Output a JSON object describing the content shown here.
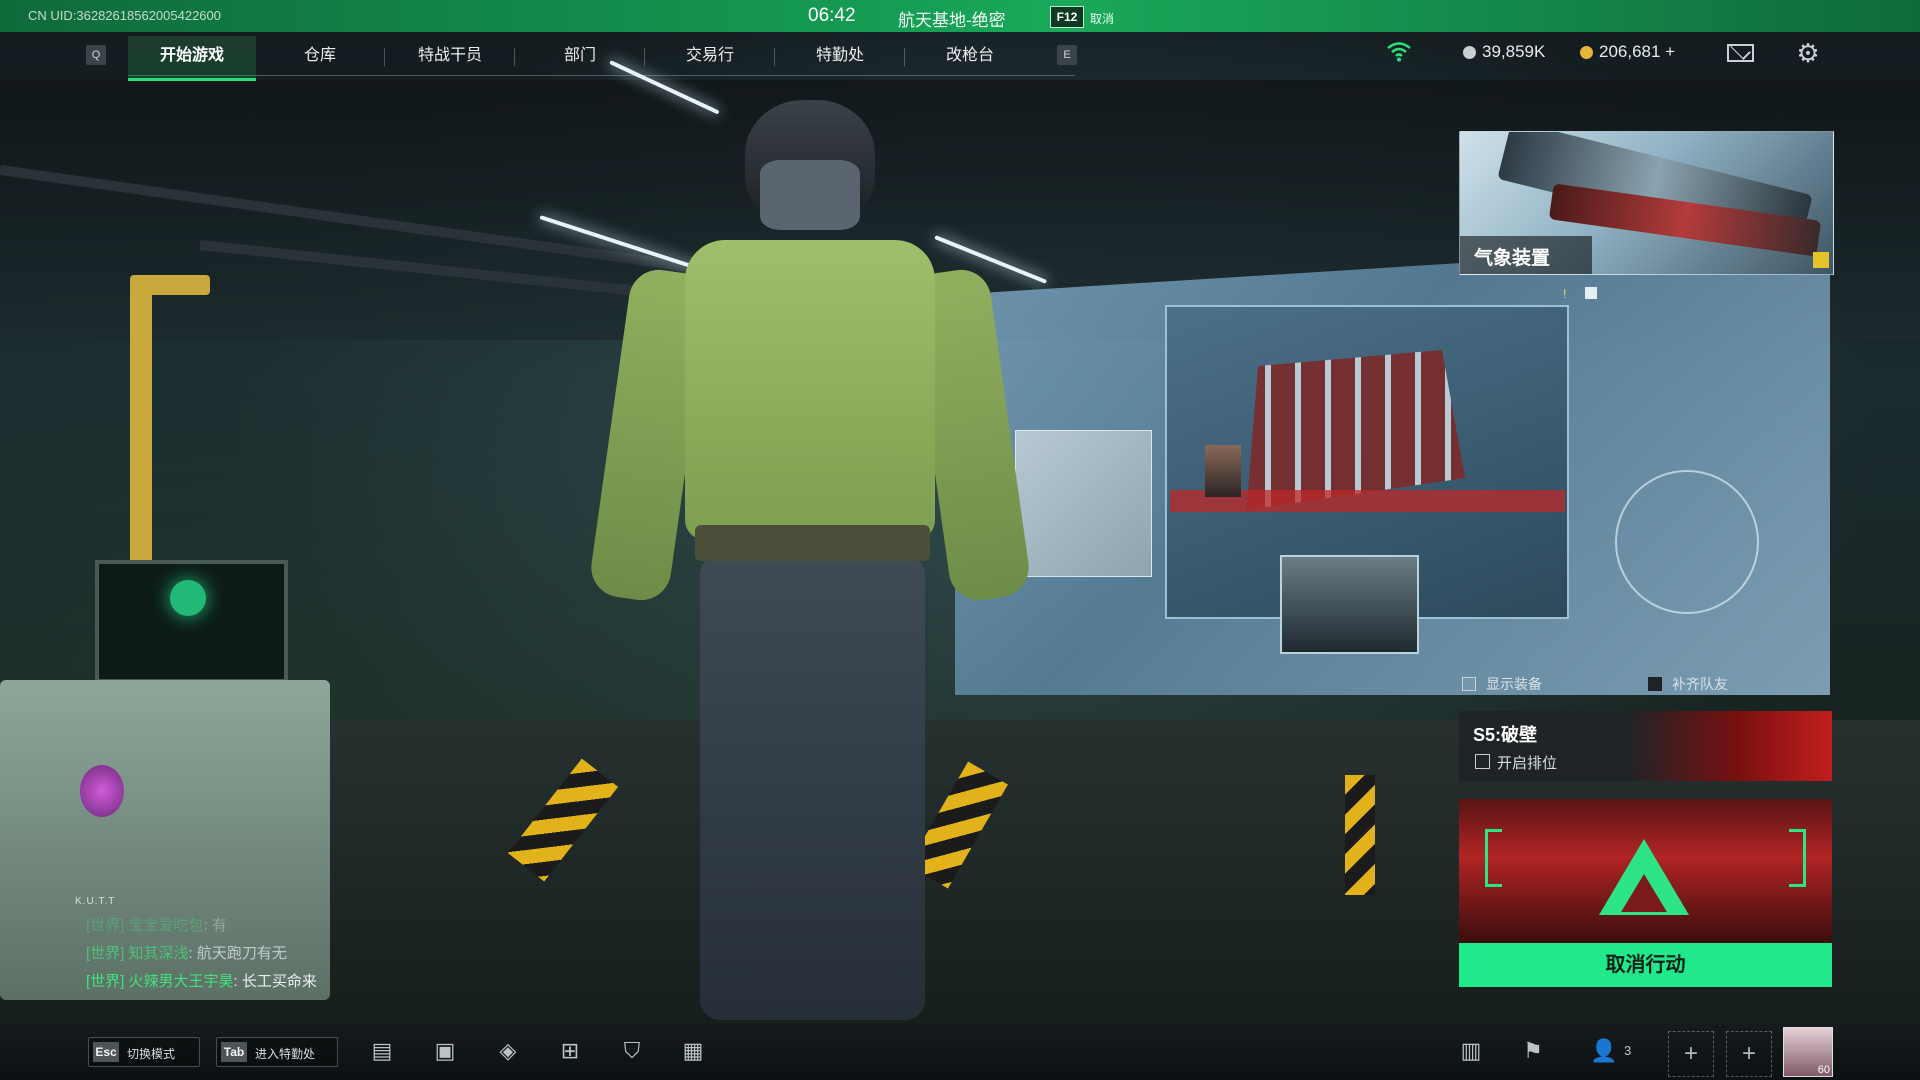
{
  "statusbar": {
    "uid": "CN UID:3628261856200542260​0",
    "clock": "06:42",
    "map_name": "航天基地-绝密",
    "f12_key": "F12",
    "f12_label": "取消"
  },
  "nav": {
    "left_key": "Q",
    "right_key": "E",
    "tabs": [
      {
        "label": "开始游戏",
        "active": true
      },
      {
        "label": "仓库",
        "active": false
      },
      {
        "label": "特战干员",
        "active": false
      },
      {
        "label": "部门",
        "active": false
      },
      {
        "label": "交易行",
        "active": false
      },
      {
        "label": "特勤处",
        "active": false
      },
      {
        "label": "改枪台",
        "active": false
      }
    ]
  },
  "hud": {
    "currency_silver": "39,859K",
    "currency_gold": "206,681 +",
    "icons": [
      "wifi-icon",
      "mail-icon",
      "gear-icon"
    ],
    "colors": {
      "accent": "#21e88a",
      "statusbar": "#159b52",
      "gold": "#e6b43a",
      "silver": "#c9d0d4"
    }
  },
  "promo": {
    "title": "气象装置"
  },
  "options": {
    "show_gear": "显示装备",
    "fill_team": "补齐队友"
  },
  "season": {
    "title": "S5:破壁",
    "ranked_label": "开启排位"
  },
  "action": {
    "cancel_label": "取消行动"
  },
  "chat": {
    "lines": [
      {
        "tag": "[世界]",
        "user": "宝宝爱吃包",
        "msg": "有",
        "faded": true
      },
      {
        "tag": "[世界]",
        "user": "知其深浅",
        "msg": "航天跑刀有无",
        "faded": true
      },
      {
        "tag": "[世界]",
        "user": "火辣男大王宇昊",
        "msg": "长工买命来",
        "faded": false
      }
    ],
    "badge": "K.U.T.T"
  },
  "bottombar": {
    "hints": [
      {
        "key": "Esc",
        "label": "切换模式"
      },
      {
        "key": "Tab",
        "label": "进入特勤处"
      }
    ],
    "icons": [
      "chat-icon",
      "shop-bag-icon",
      "badge-icon",
      "cart-icon",
      "shield-icon",
      "calendar-icon",
      "stats-icon",
      "flag-icon",
      "friends-icon"
    ],
    "friends_count": "3",
    "plus_symbol": "+",
    "avatar_level": "60"
  }
}
